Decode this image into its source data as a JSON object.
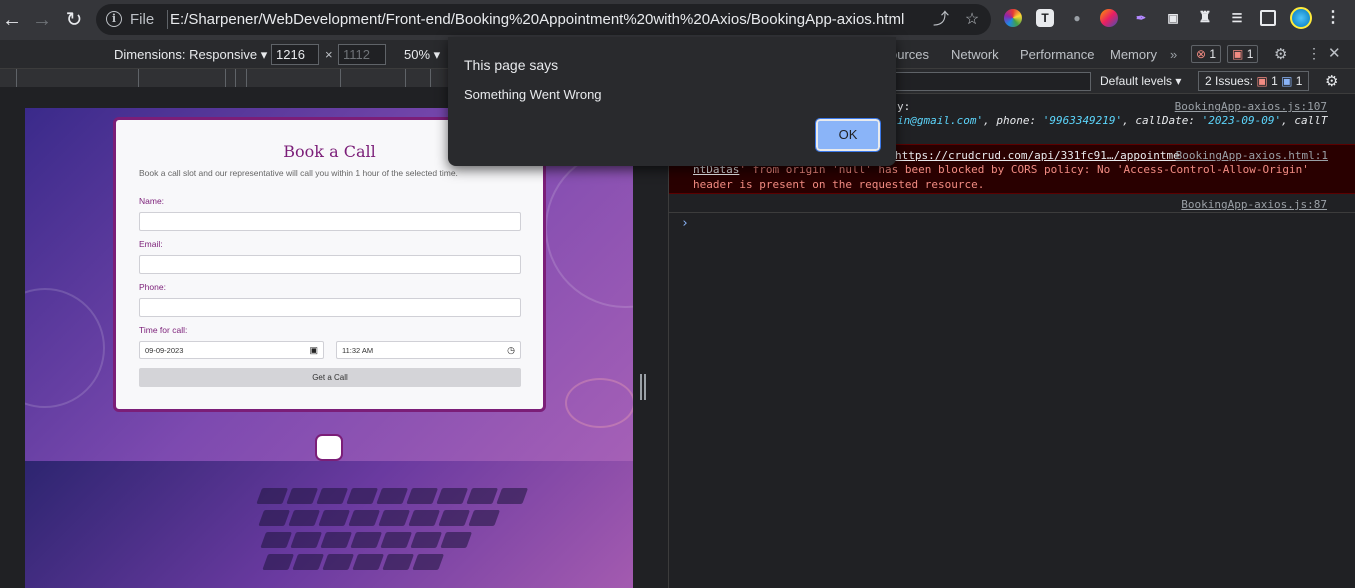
{
  "browser": {
    "file_label": "File",
    "url": "E:/Sharpener/WebDevelopment/Front-end/Booking%20Appointment%20with%20Axios/BookingApp-axios.html"
  },
  "device_toolbar": {
    "dimensions_label": "Dimensions: Responsive",
    "width": "1216",
    "height": "1112",
    "zoom": "50%"
  },
  "devtools": {
    "tabs": [
      "ources",
      "Network",
      "Performance",
      "Memory"
    ],
    "errors_count": "1",
    "warnings_count": "1",
    "default_levels": "Default levels",
    "issues_label": "2 Issues:",
    "issues_errors": "1",
    "issues_info": "1"
  },
  "console": {
    "line1_text": "y:",
    "line1_src": "BookingApp-axios.js:107",
    "line2_email": "in@gmail.com'",
    "line2_phone_key": ", phone: ",
    "line2_phone_val": "'9963349219'",
    "line2_date_key": ", callDate: ",
    "line2_date_val": "'2023-09-09'",
    "line2_tail": ", callT",
    "err_url": "https://crudcrud.com/api/331fc91…/appointme",
    "err_src": "BookingApp-axios.html:1",
    "err_line2_a": "ntDatas",
    "err_line2_b": "' from origin 'null' has been blocked by CORS policy: No 'Access-Control-Allow-Origin'",
    "err_line3": "header is present on the requested resource.",
    "line4_src": "BookingApp-axios.js:87",
    "prompt": "›"
  },
  "form": {
    "title": "Book a Call",
    "subtitle": "Book a call slot and our representative will call you within 1 hour of the selected time.",
    "name_label": "Name:",
    "email_label": "Email:",
    "phone_label": "Phone:",
    "time_label": "Time for call:",
    "date_value": "09-09-2023",
    "time_value": "11:32 AM",
    "submit_label": "Get a Call"
  },
  "alert": {
    "title": "This page says",
    "message": "Something Went Wrong",
    "ok_label": "OK"
  }
}
